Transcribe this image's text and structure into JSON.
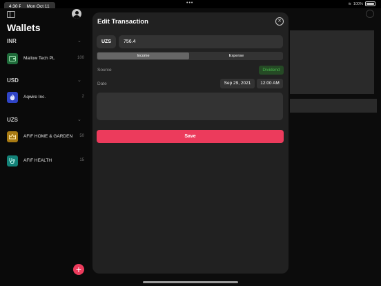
{
  "status_bar": {
    "time": "4:30 PM",
    "date": "Mon Oct 11",
    "battery": "100%"
  },
  "sidebar": {
    "title": "Wallets",
    "sections": [
      {
        "label": "INR",
        "wallets": [
          {
            "name": "Mallow Tech PL",
            "value": "100",
            "icon": "wallet-icon",
            "color": "#1f6b3a"
          }
        ]
      },
      {
        "label": "USD",
        "wallets": [
          {
            "name": "Aqwire Inc.",
            "value": "2",
            "icon": "flame-icon",
            "color": "#2f44c6"
          }
        ]
      },
      {
        "label": "UZS",
        "wallets": [
          {
            "name": "AFIF HOME & GARDEN",
            "value": "50",
            "icon": "crown-icon",
            "color": "#a87a12"
          },
          {
            "name": "AFIF HEALTH",
            "value": "15",
            "icon": "stethoscope-icon",
            "color": "#138278"
          }
        ]
      }
    ],
    "add_button": "+"
  },
  "modal": {
    "title": "Edit Transaction",
    "currency": "UZS",
    "amount": "756.4",
    "type_options": [
      "Income",
      "Expense"
    ],
    "selected_type": "Income",
    "source_label": "Source",
    "source_value": "Dividend",
    "date_label": "Date",
    "date_value": "Sep 29, 2021",
    "time_value": "12:00 AM",
    "notes_value": "",
    "save_label": "Save"
  },
  "colors": {
    "accent": "#ec3b5c",
    "positive": "#49b84c"
  }
}
